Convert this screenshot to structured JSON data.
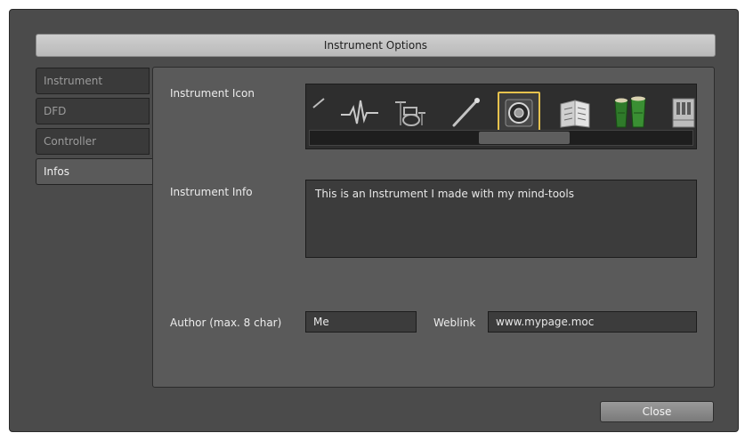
{
  "dialog": {
    "title": "Instrument Options"
  },
  "tabs": [
    {
      "label": "Instrument"
    },
    {
      "label": "DFD"
    },
    {
      "label": "Controller"
    },
    {
      "label": "Infos"
    }
  ],
  "active_tab": "Infos",
  "icon_section": {
    "label": "Instrument Icon",
    "icons": [
      "pen-icon",
      "waveform-icon",
      "drum-kit-icon",
      "drumstick-icon",
      "speaker-icon",
      "book-icon",
      "bongos-icon",
      "organ-icon"
    ],
    "selected_icon": "speaker-icon",
    "selection_color": "#e6c24d"
  },
  "info_section": {
    "label": "Instrument Info",
    "text": "This is an Instrument I made with my mind-tools"
  },
  "author": {
    "label": "Author (max. 8 char)",
    "value": "Me"
  },
  "weblink": {
    "label": "Weblink",
    "value": "www.mypage.moc"
  },
  "buttons": {
    "close": "Close"
  }
}
